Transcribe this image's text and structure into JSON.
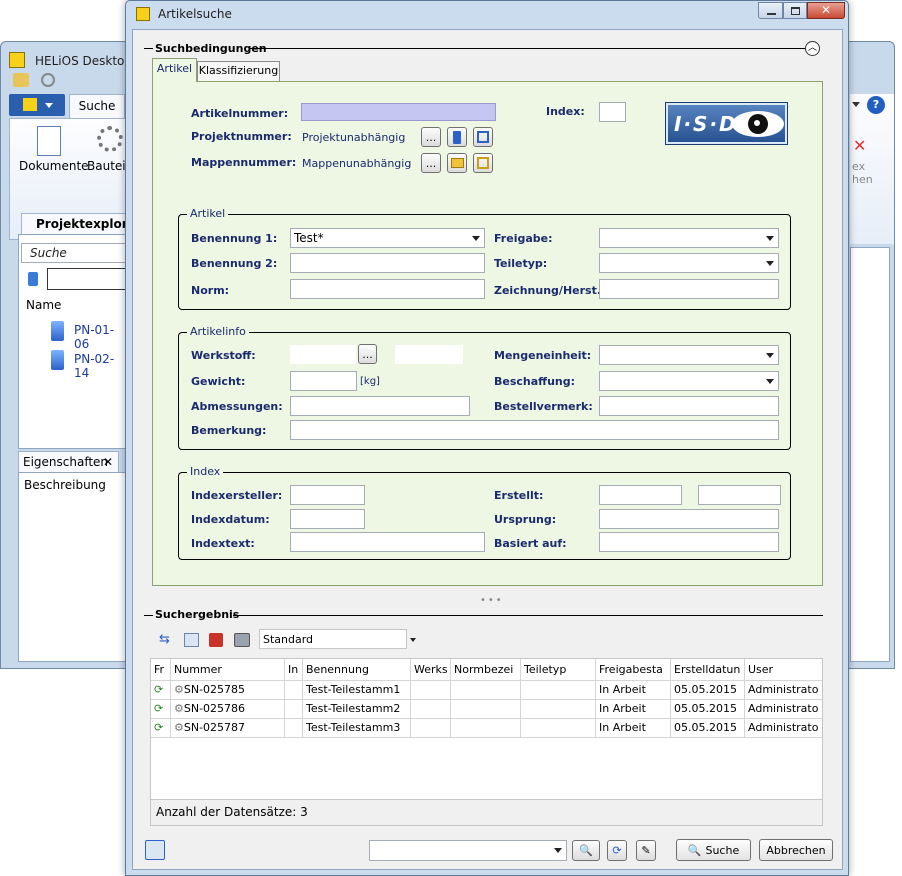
{
  "bg_window": {
    "title": "HELiOS Desktop -",
    "tab_suche": "Suche",
    "ribbon_dokumente": "Dokumente",
    "ribbon_bauteile": "Bauteile",
    "ribbon_right_top": "ex",
    "ribbon_right_bottom": "hen",
    "projektexplorer_tab": "Projektexplorer",
    "search_placeholder": "Suche",
    "name_header": "Name",
    "items": [
      "PN-01-06",
      "PN-02-14"
    ],
    "eigenschaften_tab": "Eigenschaften",
    "beschreibung": "Beschreibung"
  },
  "dialog": {
    "title": "Artikelsuche"
  },
  "suchbedingungen": {
    "header": "Suchbedingungen",
    "tabs": [
      "Artikel",
      "Klassifizierung"
    ]
  },
  "fields": {
    "artikelnummer": "Artikelnummer:",
    "index": "Index:",
    "projektnummer": "Projektnummer:",
    "projektnummer_value": "Projektunabhängig",
    "mappennummer": "Mappennummer:",
    "mappennummer_value": "Mappenunabhängig",
    "browse": "..."
  },
  "logo": {
    "text": "I·S·D"
  },
  "artikel_group": {
    "title": "Artikel",
    "benennung1": "Benennung 1:",
    "benennung1_value": "Test*",
    "benennung2": "Benennung 2:",
    "norm": "Norm:",
    "freigabe": "Freigabe:",
    "teiletyp": "Teiletyp:",
    "zeichnung": "Zeichnung/Herst.:"
  },
  "artikelinfo_group": {
    "title": "Artikelinfo",
    "werkstoff": "Werkstoff:",
    "gewicht": "Gewicht:",
    "gewicht_unit": "[kg]",
    "abmessungen": "Abmessungen:",
    "bemerkung": "Bemerkung:",
    "mengeneinheit": "Mengeneinheit:",
    "beschaffung": "Beschaffung:",
    "bestellvermerk": "Bestellvermerk:"
  },
  "index_group": {
    "title": "Index",
    "indexersteller": "Indexersteller:",
    "indexdatum": "Indexdatum:",
    "indextext": "Indextext:",
    "erstellt": "Erstellt:",
    "ursprung": "Ursprung:",
    "basiert": "Basiert auf:"
  },
  "suchergebnis": {
    "header": "Suchergebnis",
    "view": "Standard",
    "columns": [
      "Fr",
      "Nummer",
      "In",
      "Benennung",
      "Werks",
      "Normbezei",
      "Teiletyp",
      "Freigabesta",
      "Erstelldatun",
      "User"
    ],
    "rows": [
      {
        "nummer": "SN-025785",
        "benennung": "Test-Teilestamm1",
        "freigabe": "In Arbeit",
        "datum": "05.05.2015",
        "user": "Administrato"
      },
      {
        "nummer": "SN-025786",
        "benennung": "Test-Teilestamm2",
        "freigabe": "In Arbeit",
        "datum": "05.05.2015",
        "user": "Administrato"
      },
      {
        "nummer": "SN-025787",
        "benennung": "Test-Teilestamm3",
        "freigabe": "In Arbeit",
        "datum": "05.05.2015",
        "user": "Administrato"
      }
    ],
    "count": "Anzahl der Datensätze: 3"
  },
  "footer": {
    "suche": "Suche",
    "abbrechen": "Abbrechen"
  },
  "colors": {
    "green_panel": "#eef6e4",
    "artikelnr_fill": "#c6c6f2",
    "label": "#1a2a6e",
    "logo_bg": "#2e5d9e"
  }
}
